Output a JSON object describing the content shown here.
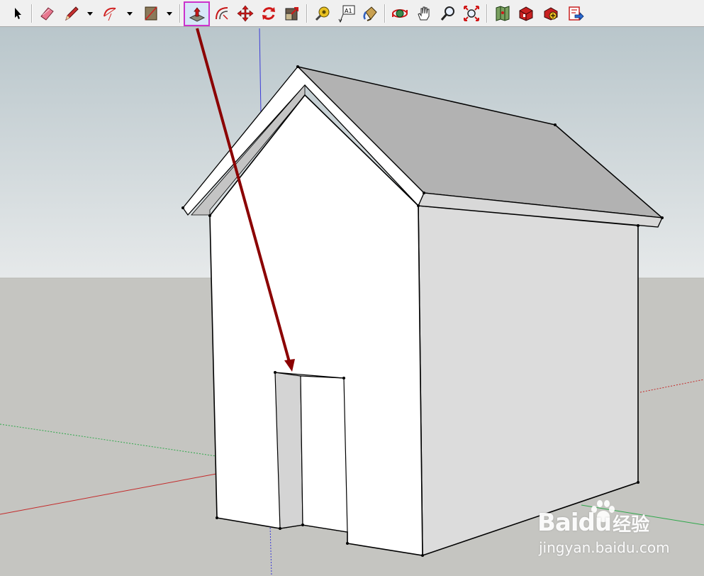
{
  "colors": {
    "sky_top": "#b9c6cb",
    "sky_bottom": "#e6e9ea",
    "ground": "#c5c5c1",
    "roof": "#b2b2b2",
    "wall_front": "#ffffff",
    "wall_side": "#dcdcdc",
    "edge": "#000000",
    "axis_blue": "#3b3bd8",
    "axis_red": "#c42a2a",
    "axis_green": "#2ea84a",
    "annotation_arrow": "#8b0000",
    "active_tool_border": "#cc33cc"
  },
  "toolbar": {
    "tools": [
      {
        "name": "select",
        "icon": "arrow-cursor-icon"
      },
      {
        "name": "eraser",
        "icon": "eraser-icon"
      },
      {
        "name": "pencil",
        "icon": "pencil-icon",
        "dropdown": true
      },
      {
        "name": "arc",
        "icon": "arc-icon",
        "dropdown": true
      },
      {
        "name": "rectangle",
        "icon": "rectangle-icon",
        "dropdown": true
      },
      {
        "name": "push-pull",
        "icon": "push-pull-icon",
        "active": true
      },
      {
        "name": "offset",
        "icon": "offset-icon"
      },
      {
        "name": "move",
        "icon": "move-icon"
      },
      {
        "name": "rotate",
        "icon": "rotate-icon"
      },
      {
        "name": "scale",
        "icon": "scale-icon"
      },
      {
        "name": "tape-measure",
        "icon": "tape-measure-icon"
      },
      {
        "name": "text",
        "icon": "text-icon",
        "label": "A1"
      },
      {
        "name": "paint-bucket",
        "icon": "paint-bucket-icon"
      },
      {
        "name": "orbit",
        "icon": "orbit-icon"
      },
      {
        "name": "pan",
        "icon": "pan-hand-icon"
      },
      {
        "name": "zoom",
        "icon": "zoom-icon"
      },
      {
        "name": "zoom-extents",
        "icon": "zoom-extents-icon"
      },
      {
        "name": "add-location",
        "icon": "map-icon"
      },
      {
        "name": "3d-warehouse",
        "icon": "warehouse-icon"
      },
      {
        "name": "extension-warehouse",
        "icon": "extension-icon"
      },
      {
        "name": "send-to-layout",
        "icon": "layout-icon"
      }
    ]
  },
  "watermark": {
    "logo_latin": "Bai",
    "logo_du": "du",
    "logo_cn": "经验",
    "url": "jingyan.baidu.com"
  }
}
